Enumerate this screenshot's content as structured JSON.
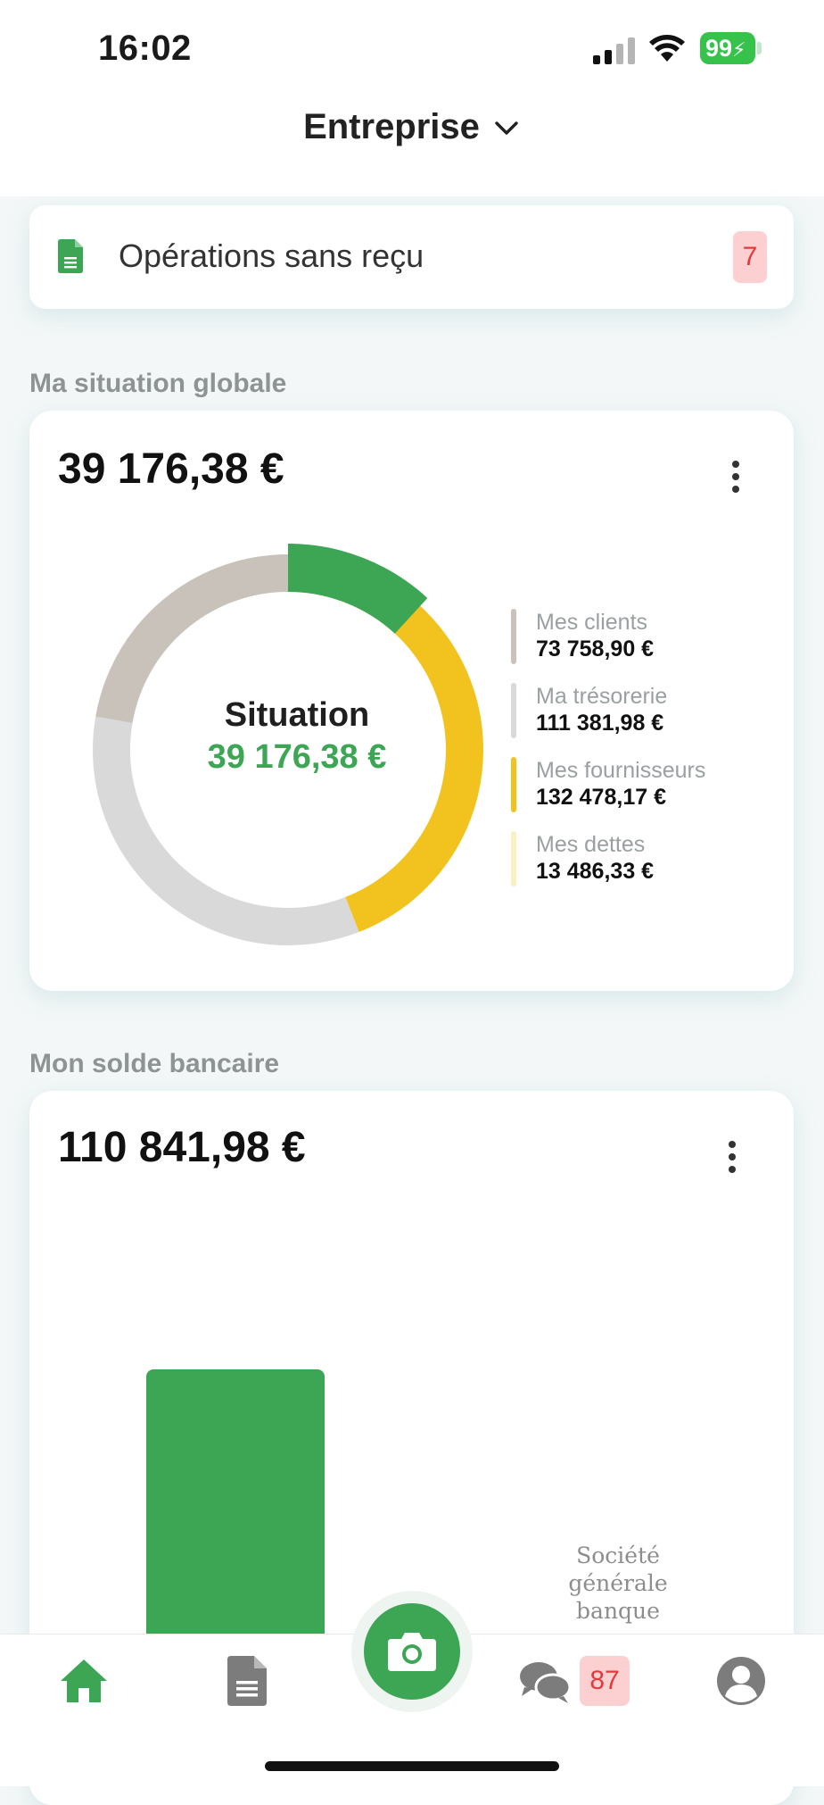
{
  "status_bar": {
    "time": "16:02",
    "battery": "99"
  },
  "header": {
    "company": "Entreprise"
  },
  "receipts": {
    "label": "Opérations sans reçu",
    "count": "7"
  },
  "situation": {
    "section_title": "Ma situation globale",
    "amount": "39 176,38 €",
    "center_title": "Situation",
    "center_amount": "39 176,38 €"
  },
  "chart_data": [
    {
      "type": "pie",
      "title": "",
      "categories": [
        "Mes clients",
        "Ma trésorerie",
        "Mes fournisseurs",
        "Mes dettes",
        "Situation"
      ],
      "labels": [
        "73 758,90 €",
        "111 381,98 €",
        "132 478,17 €",
        "13 486,33 €",
        "39 176,38 €"
      ],
      "values": [
        73758.9,
        111381.98,
        132478.17,
        13486.33,
        39176.38
      ],
      "colors": [
        "#c9c2bb",
        "#d9d9d9",
        "#f2c31e",
        "#fbf0c0",
        "#3ca655"
      ],
      "legend": "right"
    },
    {
      "type": "bar",
      "title": "",
      "categories": [
        "Société générale banque"
      ],
      "values": [
        110841.98
      ],
      "colors": [
        "#3ca655"
      ]
    }
  ],
  "bank": {
    "section_title": "Mon solde bancaire",
    "amount": "110 841,98 €",
    "bar_label": "Société générale banque"
  },
  "tabbar": {
    "messages_count": "87"
  },
  "icons": [
    "home-icon",
    "document-icon",
    "camera-icon",
    "chat-icon",
    "user-icon",
    "chevron-down-icon",
    "receipt-icon"
  ]
}
